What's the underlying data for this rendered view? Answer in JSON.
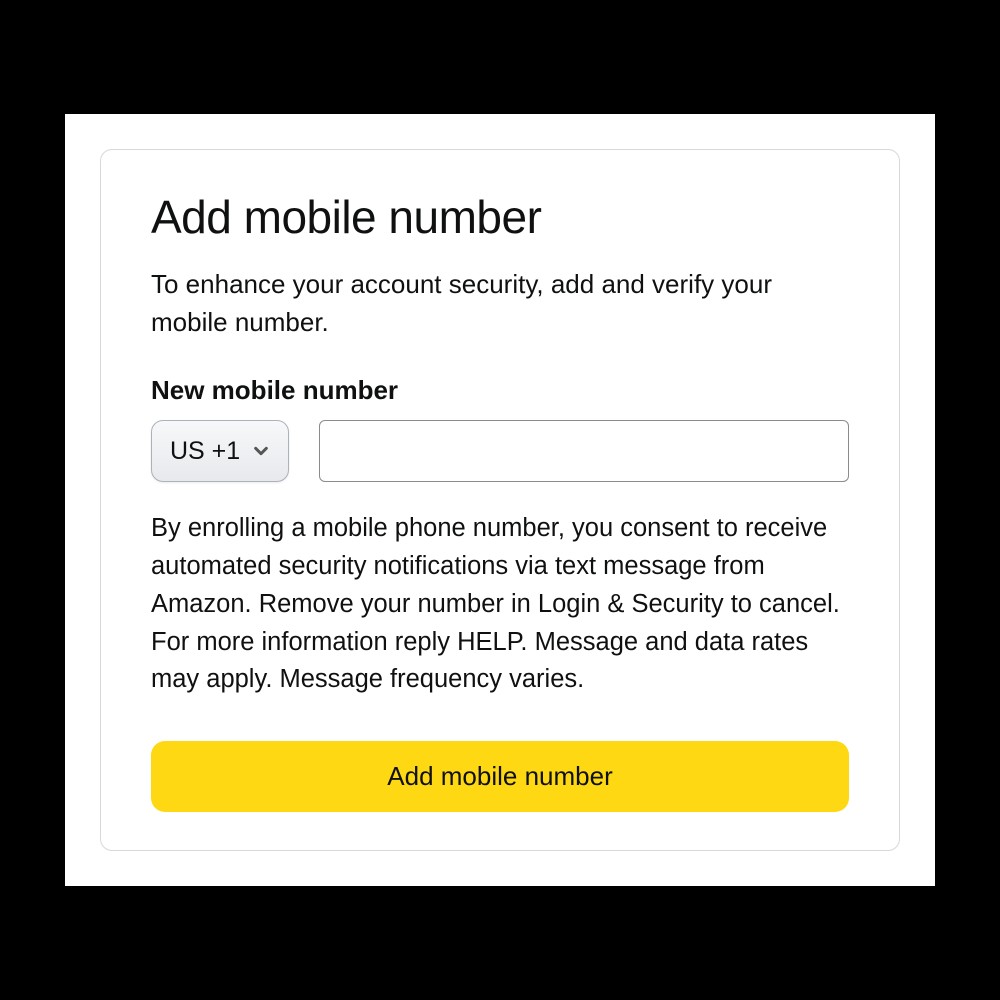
{
  "modal": {
    "title": "Add mobile number",
    "description": "To enhance your account security, add and verify your mobile number.",
    "field_label": "New mobile number",
    "country_code": "US +1",
    "phone_value": "",
    "consent_text": "By enrolling a mobile phone number, you consent to receive automated security notifications via text message from Amazon. Remove your number in Login & Security to cancel. For more information reply HELP. Message and data rates may apply. Message frequency varies.",
    "submit_label": "Add mobile number"
  },
  "colors": {
    "primary_button": "#ffd814",
    "border": "#d5d9d9",
    "text": "#0f1111"
  }
}
